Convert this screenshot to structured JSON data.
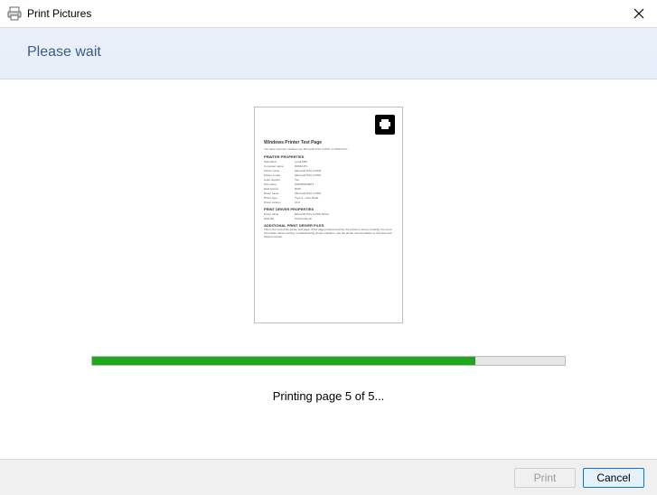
{
  "window": {
    "title": "Print Pictures"
  },
  "banner": {
    "heading": "Please wait"
  },
  "preview": {
    "doc_title": "Windows Printer Test Page",
    "subline": "You have correctly installed your Microsoft Print to PDF on WIN10-PC",
    "section_printer": "PRINTER PROPERTIES",
    "rows": [
      {
        "k": "Submitted",
        "v": "Local PDF"
      },
      {
        "k": "Computer name",
        "v": "WIN10-PC"
      },
      {
        "k": "Printer name",
        "v": "Microsoft Print to PDF"
      },
      {
        "k": "Printer model",
        "v": "Microsoft Print to PDF"
      },
      {
        "k": "Color support",
        "v": "Yes"
      },
      {
        "k": "Port name",
        "v": "PORTPROMPT:"
      },
      {
        "k": "Data format",
        "v": "RAW"
      },
      {
        "k": "Driver name",
        "v": "Microsoft Print to PDF"
      },
      {
        "k": "Driver type",
        "v": "Type 4 - User Mode"
      },
      {
        "k": "Driver version",
        "v": "10.0"
      }
    ],
    "section_driver": "PRINT DRIVER PROPERTIES",
    "rows2": [
      {
        "k": "Driver name",
        "v": "Microsoft Print to PDF Driver"
      },
      {
        "k": "Data file",
        "v": "PrintConfig.dll"
      }
    ],
    "section_add": "ADDITIONAL PRINT DRIVER FILES",
    "paragraph": "This is the end of the printer test page. If this page printed correctly, the printer is set up correctly. For more information about printing, troubleshooting printer problems, see the printer documentation or the Help and Support Center."
  },
  "progress": {
    "percent": 81
  },
  "status": {
    "text": "Printing page 5 of 5..."
  },
  "footer": {
    "print_label": "Print",
    "cancel_label": "Cancel"
  }
}
